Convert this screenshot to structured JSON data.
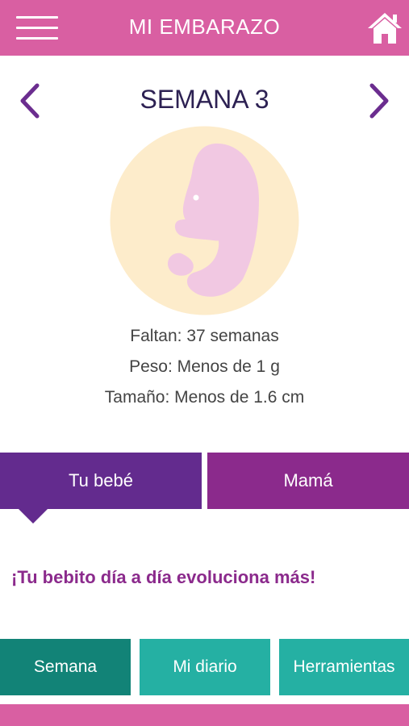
{
  "header": {
    "title": "MI EMBARAZO",
    "menu_icon": "hamburger-menu-icon",
    "home_icon": "home-icon"
  },
  "week": {
    "title": "SEMANA 3",
    "prev_icon": "chevron-left-icon",
    "next_icon": "chevron-right-icon"
  },
  "illustration": {
    "icon": "embryo-illustration"
  },
  "info": {
    "remaining": "Faltan: 37 semanas",
    "weight": "Peso: Menos de 1 g",
    "size": "Tamaño: Menos de 1.6 cm"
  },
  "tabs": [
    {
      "label": "Tu bebé",
      "selected": true
    },
    {
      "label": "Mamá",
      "selected": false
    }
  ],
  "tagline": "¡Tu bebito día a día evoluciona más!",
  "bottom_nav": [
    {
      "label": "Semana",
      "selected": true
    },
    {
      "label": "Mi diario",
      "selected": false
    },
    {
      "label": "Herramientas",
      "selected": false
    }
  ],
  "colors": {
    "header": "#d95fa2",
    "nav_arrow": "#6b2d8f",
    "title_text": "#2d2153",
    "tab_baby": "#632b8e",
    "tab_mom": "#8b2a8c",
    "tagline": "#8b2a8c",
    "bottom_selected": "#128377",
    "bottom_default": "#25b0a3",
    "circle": "#fdeccb",
    "embryo": "#f1c8e2"
  }
}
